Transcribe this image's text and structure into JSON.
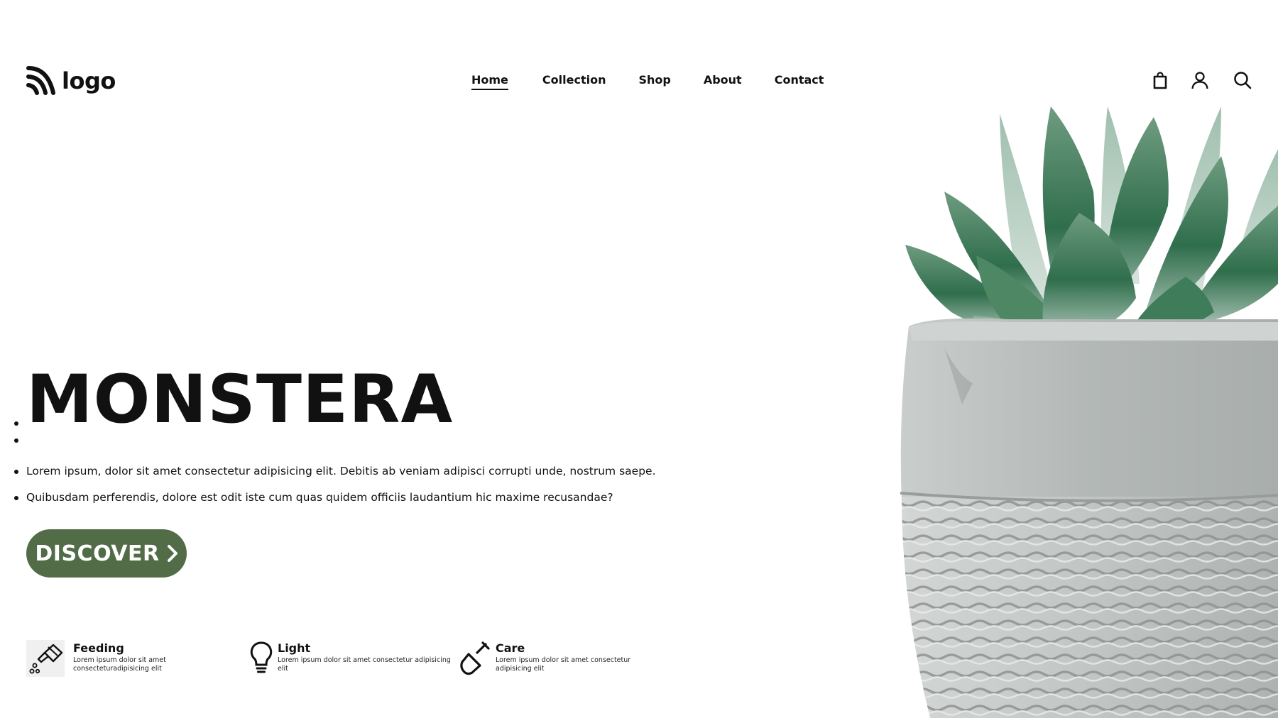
{
  "header": {
    "logo_text": "logo",
    "nav": [
      {
        "label": "Home",
        "active": true
      },
      {
        "label": "Collection",
        "active": false
      },
      {
        "label": "Shop",
        "active": false
      },
      {
        "label": "About",
        "active": false
      },
      {
        "label": "Contact",
        "active": false
      }
    ],
    "icons": [
      "shopping-bag-icon",
      "user-icon",
      "search-icon"
    ]
  },
  "hero": {
    "title": "MONSTERA",
    "description": [
      "Lorem ipsum, dolor sit amet consectetur adipisicing elit. Debitis ab veniam adipisci corrupti unde, nostrum saepe.",
      "Quibusdam perferendis, dolore est odit iste cum quas quidem officiis laudantium hic maxime recusandae?"
    ],
    "cta_label": "DISCOVER",
    "image": "succulent-in-concrete-pot"
  },
  "features": [
    {
      "icon": "watering-can-icon",
      "title": "Feeding",
      "text": "Lorem ipsum dolor sit amet consecteturadipisicing elit"
    },
    {
      "icon": "light-bulb-icon",
      "title": "Light",
      "text": "Lorem ipsum dolor sit amet consectetur adipisicing elit"
    },
    {
      "icon": "shovel-icon",
      "title": "Care",
      "text": "Lorem ipsum dolor sit amet consectetur adipisicing elit"
    }
  ],
  "colors": {
    "accent": "#516c47",
    "text": "#111111",
    "background": "#ffffff",
    "leaf": "#3d7a57",
    "pot": "#b8bcbb"
  }
}
